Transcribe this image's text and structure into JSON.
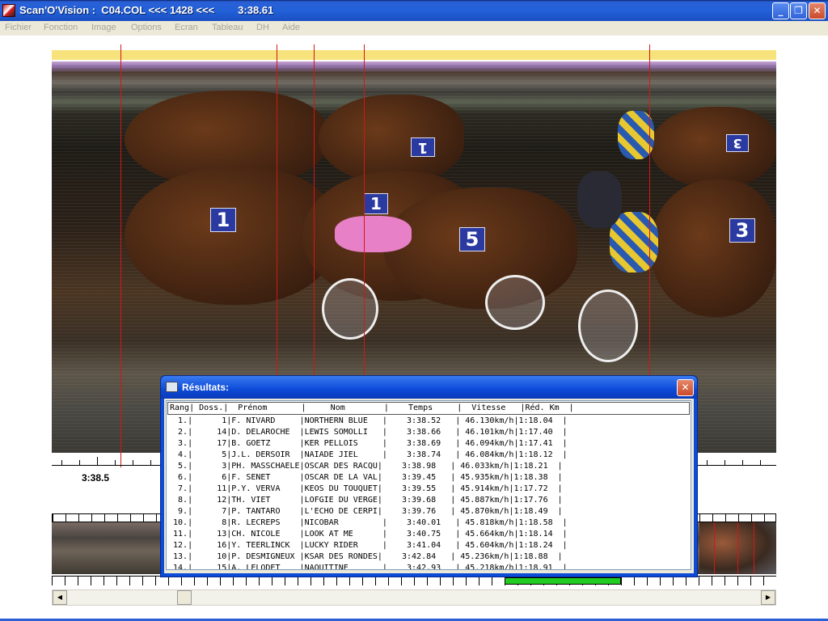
{
  "window": {
    "title": "Scan'O'Vision :  C04.COL <<< 1428 <<<        3:38.61",
    "buttons": {
      "minimize": "_",
      "maximize": "❐",
      "close": "✕"
    }
  },
  "menu": [
    "Fichier",
    "Fonction",
    "Image",
    "Options",
    "Ecran",
    "Tableau",
    "DH",
    "Aide"
  ],
  "photo": {
    "saddle_numbers": [
      "1",
      "1",
      "5",
      "3",
      "1",
      "3"
    ]
  },
  "ruler": {
    "time_label": "3:38.5"
  },
  "dialog": {
    "title": "Résultats:",
    "header": "Rang| Doss.|  Prénom       |     Nom        |    Temps     |  Vitesse   |Réd. Km  |",
    "rows": [
      "  1.|      1|F. NIVARD     |NORTHERN BLUE   |    3:38.52   | 46.130km/h|1:18.04  |",
      "  2.|     14|D. DELAROCHE  |LEWIS SOMOLLI   |    3:38.66   | 46.101km/h|1:17.40  |",
      "  3.|     17|B. GOETZ      |KER PELLOIS     |    3:38.69   | 46.094km/h|1:17.41  |",
      "  4.|      5|J.L. DERSOIR  |NAIADE JIEL     |    3:38.74   | 46.084km/h|1:18.12  |",
      "  5.|      3|PH. MASSCHAELE|OSCAR DES RACQU|    3:38.98   | 46.033km/h|1:18.21  |",
      "  6.|      6|F. SENET      |OSCAR DE LA VAL|    3:39.45   | 45.935km/h|1:18.38  |",
      "  7.|     11|P.Y. VERVA    |KEOS DU TOUQUET|    3:39.55   | 45.914km/h|1:17.72  |",
      "  8.|     12|TH. VIET      |LOFGIE DU VERGE|    3:39.68   | 45.887km/h|1:17.76  |",
      "  9.|      7|P. TANTARO    |L'ECHO DE CERPI|    3:39.76   | 45.870km/h|1:18.49  |",
      " 10.|      8|R. LECREPS    |NICOBAR         |    3:40.01   | 45.818km/h|1:18.58  |",
      " 11.|     13|CH. NICOLE    |LOOK AT ME      |    3:40.75   | 45.664km/h|1:18.14  |",
      " 12.|     16|Y. TEERLINCK  |LUCKY RIDER     |    3:41.04   | 45.604km/h|1:18.24  |",
      " 13.|     10|P. DESMIGNEUX |KSAR DES RONDES|    3:42.84   | 45.236km/h|1:18.88  |",
      " 14.|     15|A. LELODET    |NAQUITINE       |    3:42.93   | 45.218km/h|1:18.91  |"
    ]
  }
}
